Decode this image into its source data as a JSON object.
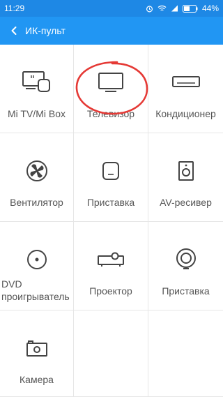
{
  "status_bar": {
    "time": "11:29",
    "battery": "44%"
  },
  "app_bar": {
    "title": "ИК-пульт"
  },
  "devices": [
    {
      "label": "Mi TV/Mi Box",
      "icon": "mi-tv-box-icon"
    },
    {
      "label": "Телевизор",
      "icon": "tv-icon"
    },
    {
      "label": "Кондиционер",
      "icon": "air-conditioner-icon"
    },
    {
      "label": "Вентилятор",
      "icon": "fan-icon"
    },
    {
      "label": "Приставка",
      "icon": "set-top-box-icon"
    },
    {
      "label": "AV-ресивер",
      "icon": "av-receiver-icon"
    },
    {
      "label_line1": "DVD",
      "label_line2": "проигрыватель",
      "icon": "dvd-player-icon"
    },
    {
      "label": "Проектор",
      "icon": "projector-icon"
    },
    {
      "label": "Приставка",
      "icon": "streaming-box-icon"
    },
    {
      "label": "Камера",
      "icon": "camera-icon"
    }
  ],
  "colors": {
    "app_bar": "#2196f3",
    "status_bar": "#1e88e5",
    "highlight": "#e53935"
  }
}
